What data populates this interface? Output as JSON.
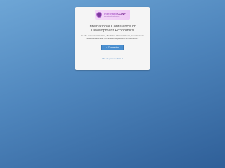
{
  "logo": {
    "word_light": "internatio",
    "word_bold": "CONF",
    "subtitle": "international conference"
  },
  "conference": {
    "title": "International Conference on Development Economics",
    "notice": "Le site est en construction, Seuls les administrateurs, coordinateurs et webmasters de la conférence peuvent se connecter."
  },
  "login": {
    "button_label": "Connexion",
    "forgot_link": "Mot de passe oublié ?"
  },
  "colors": {
    "background_top": "#6ea6d6",
    "background_bottom": "#2f5f98",
    "button": "#4a8fd0",
    "link": "#5a8fc6"
  },
  "icons": {
    "button_icon": "user-icon"
  }
}
